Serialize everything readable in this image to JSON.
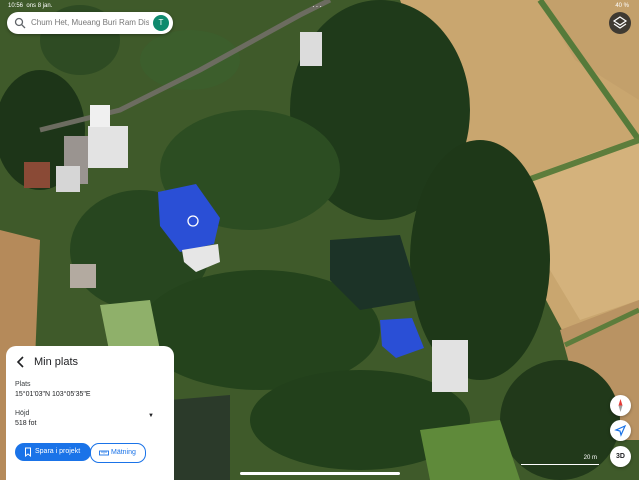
{
  "status_bar": {
    "time": "10:56",
    "date": "ons 8 jan.",
    "battery": "40 %"
  },
  "search": {
    "placeholder": "Chum Het, Mueang Buri Ram Distr",
    "avatar_letter": "T"
  },
  "panel": {
    "title": "Min plats",
    "place_label": "Plats",
    "place_value": "15°01'03\"N 103°05'35\"E",
    "elevation_label": "Höjd",
    "elevation_value": "518 fot",
    "save_button": "Spara i projekt",
    "measure_button": "Mätning"
  },
  "map_controls": {
    "threed_label": "3D",
    "scale_label": "20 m"
  },
  "colors": {
    "accent": "#1a73e8",
    "avatar": "#0f8a6e",
    "roof_blue": "#2a4fd6"
  },
  "icons": [
    "search-icon",
    "layers-icon",
    "back-icon",
    "bookmark-icon",
    "ruler-icon",
    "compass-icon",
    "location-arrow-icon"
  ]
}
